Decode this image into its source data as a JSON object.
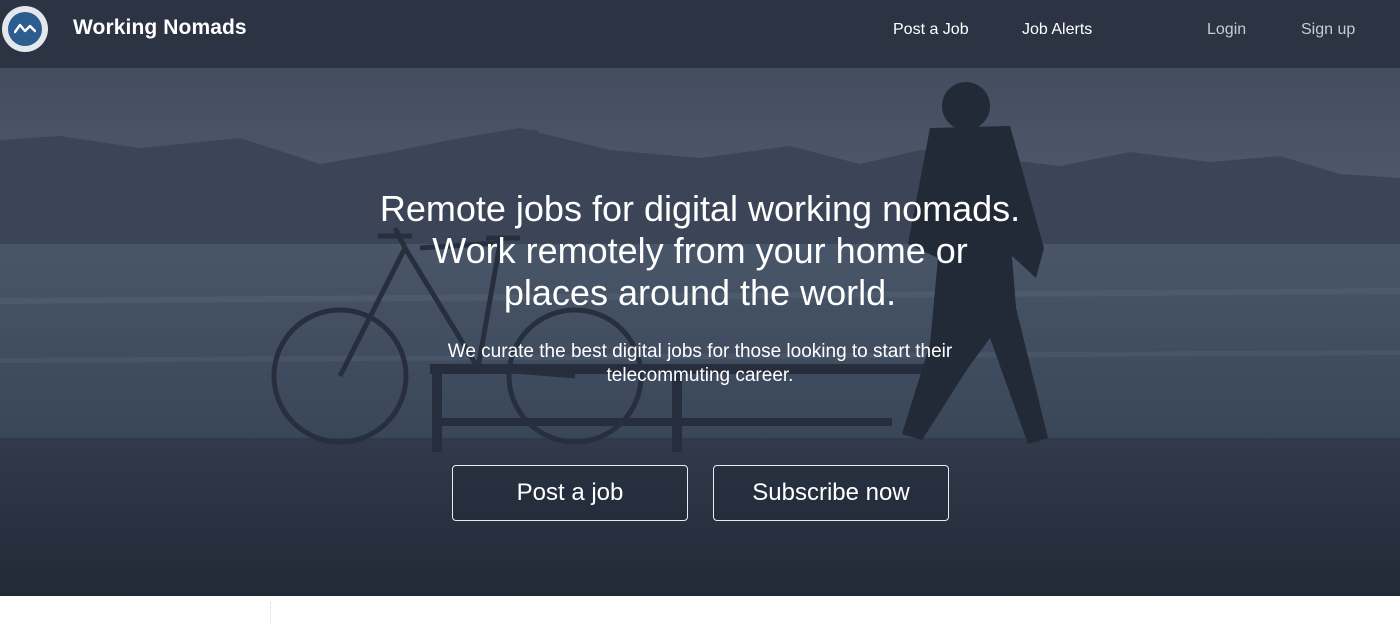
{
  "header": {
    "brand": "Working Nomads",
    "nav": {
      "post_job": "Post a Job",
      "job_alerts": "Job Alerts",
      "login": "Login",
      "signup": "Sign up"
    }
  },
  "hero": {
    "headline_lines": [
      "Remote jobs for digital working nomads.",
      "Work remotely from your home or",
      "places around the world."
    ],
    "subtext_lines": [
      "We curate the best digital jobs for those looking to start their",
      "telecommuting career."
    ],
    "buttons": {
      "post_job": "Post a job",
      "subscribe": "Subscribe now"
    }
  },
  "colors": {
    "header_bg": "#2c3343",
    "hero_tint": "#3a4558",
    "logo_blue": "#2c5d8f",
    "text": "#ffffff"
  },
  "icons": {
    "logo": "wave-logo-icon"
  }
}
